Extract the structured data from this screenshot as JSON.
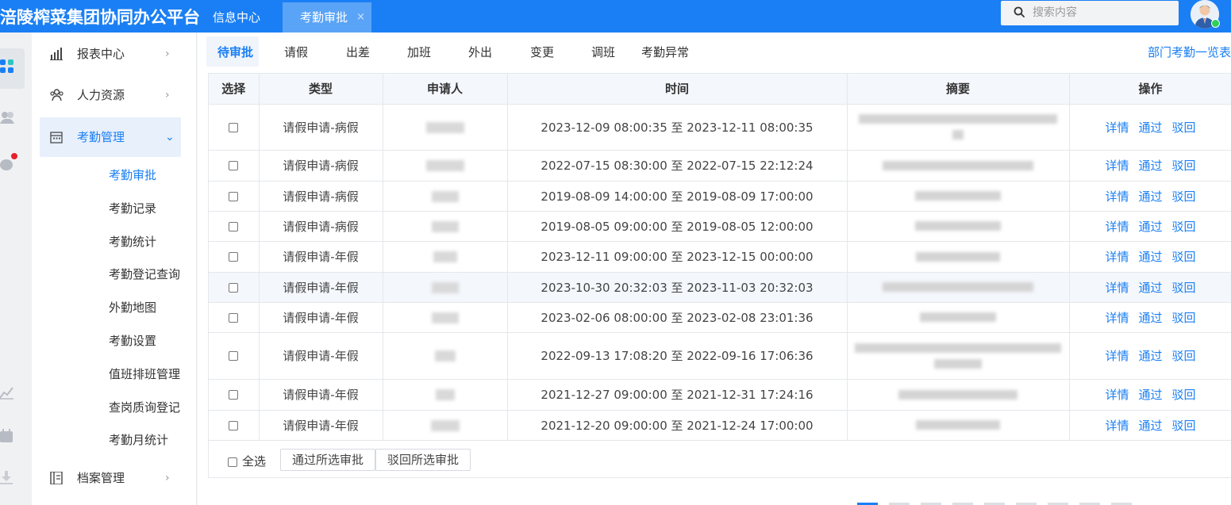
{
  "app": {
    "brand": "涪陵榨菜集团协同办公平台",
    "top_tabs": [
      {
        "label": "信息中心"
      },
      {
        "label": "考勤审批",
        "close": "×"
      }
    ],
    "search_placeholder": "搜索内容"
  },
  "sidebar": {
    "groups": [
      {
        "label": "报表中心",
        "icon": "bar-chart-icon",
        "chev": "›"
      },
      {
        "label": "人力资源",
        "icon": "people-icon",
        "chev": "›"
      },
      {
        "label": "考勤管理",
        "icon": "calendar-icon",
        "chev": "⌄"
      },
      {
        "label": "档案管理",
        "icon": "archive-icon",
        "chev": "›"
      }
    ],
    "sub_items": [
      "考勤审批",
      "考勤记录",
      "考勤统计",
      "考勤登记查询",
      "外勤地图",
      "考勤设置",
      "值班排班管理",
      "查岗质询登记",
      "考勤月统计"
    ]
  },
  "tabs": [
    "待审批",
    "请假",
    "出差",
    "加班",
    "外出",
    "变更",
    "调班",
    "考勤异常"
  ],
  "dept_link": "部门考勤一览表",
  "table": {
    "headers": [
      "选择",
      "类型",
      "申请人",
      "时间",
      "摘要",
      "操作"
    ],
    "rows": [
      {
        "type": "请假申请-病假",
        "time": "2023-12-09 08:00:35 至 2023-12-11 08:00:35"
      },
      {
        "type": "请假申请-病假",
        "time": "2022-07-15 08:30:00 至 2022-07-15 22:12:24"
      },
      {
        "type": "请假申请-病假",
        "time": "2019-08-09 14:00:00 至 2019-08-09 17:00:00"
      },
      {
        "type": "请假申请-病假",
        "time": "2019-08-05 09:00:00 至 2019-08-05 12:00:00"
      },
      {
        "type": "请假申请-年假",
        "time": "2023-12-11 09:00:00 至 2023-12-15 00:00:00"
      },
      {
        "type": "请假申请-年假",
        "time": "2023-10-30 20:32:03 至 2023-11-03 20:32:03"
      },
      {
        "type": "请假申请-年假",
        "time": "2023-02-06 08:00:00 至 2023-02-08 23:01:36"
      },
      {
        "type": "请假申请-年假",
        "time": "2022-09-13 17:08:20 至 2022-09-16 17:06:36"
      },
      {
        "type": "请假申请-年假",
        "time": "2021-12-27 09:00:00 至 2021-12-31 17:24:16"
      },
      {
        "type": "请假申请-年假",
        "time": "2021-12-20 09:00:00 至 2021-12-24 17:00:00"
      }
    ],
    "ops": [
      "详情",
      "通过",
      "驳回"
    ]
  },
  "footer": {
    "select_all": "全选",
    "approve_selected": "通过所选审批",
    "reject_selected": "驳回所选审批"
  },
  "colors": {
    "primary": "#1a7ff4",
    "badge": "#e8202a",
    "online": "#2ed05a"
  }
}
